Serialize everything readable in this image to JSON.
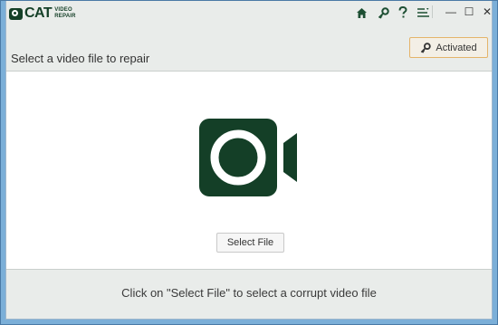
{
  "app": {
    "logo_main": "CAT",
    "logo_sub_1": "VIDEO",
    "logo_sub_2": "REPAIR"
  },
  "titlebar_icons": [
    "home-icon",
    "key-icon",
    "help-icon",
    "menu-icon"
  ],
  "window_controls": {
    "minimize": "—",
    "maximize": "☐",
    "close": "✕"
  },
  "header": {
    "title": "Select a video file to repair",
    "activated_label": "Activated"
  },
  "main": {
    "select_file_label": "Select File"
  },
  "footer": {
    "hint": "Click on \"Select File\" to select a corrupt video file"
  },
  "colors": {
    "brand_green": "#143f27",
    "activated_border": "#e4b46a",
    "panel_bg": "#e9ecea"
  }
}
